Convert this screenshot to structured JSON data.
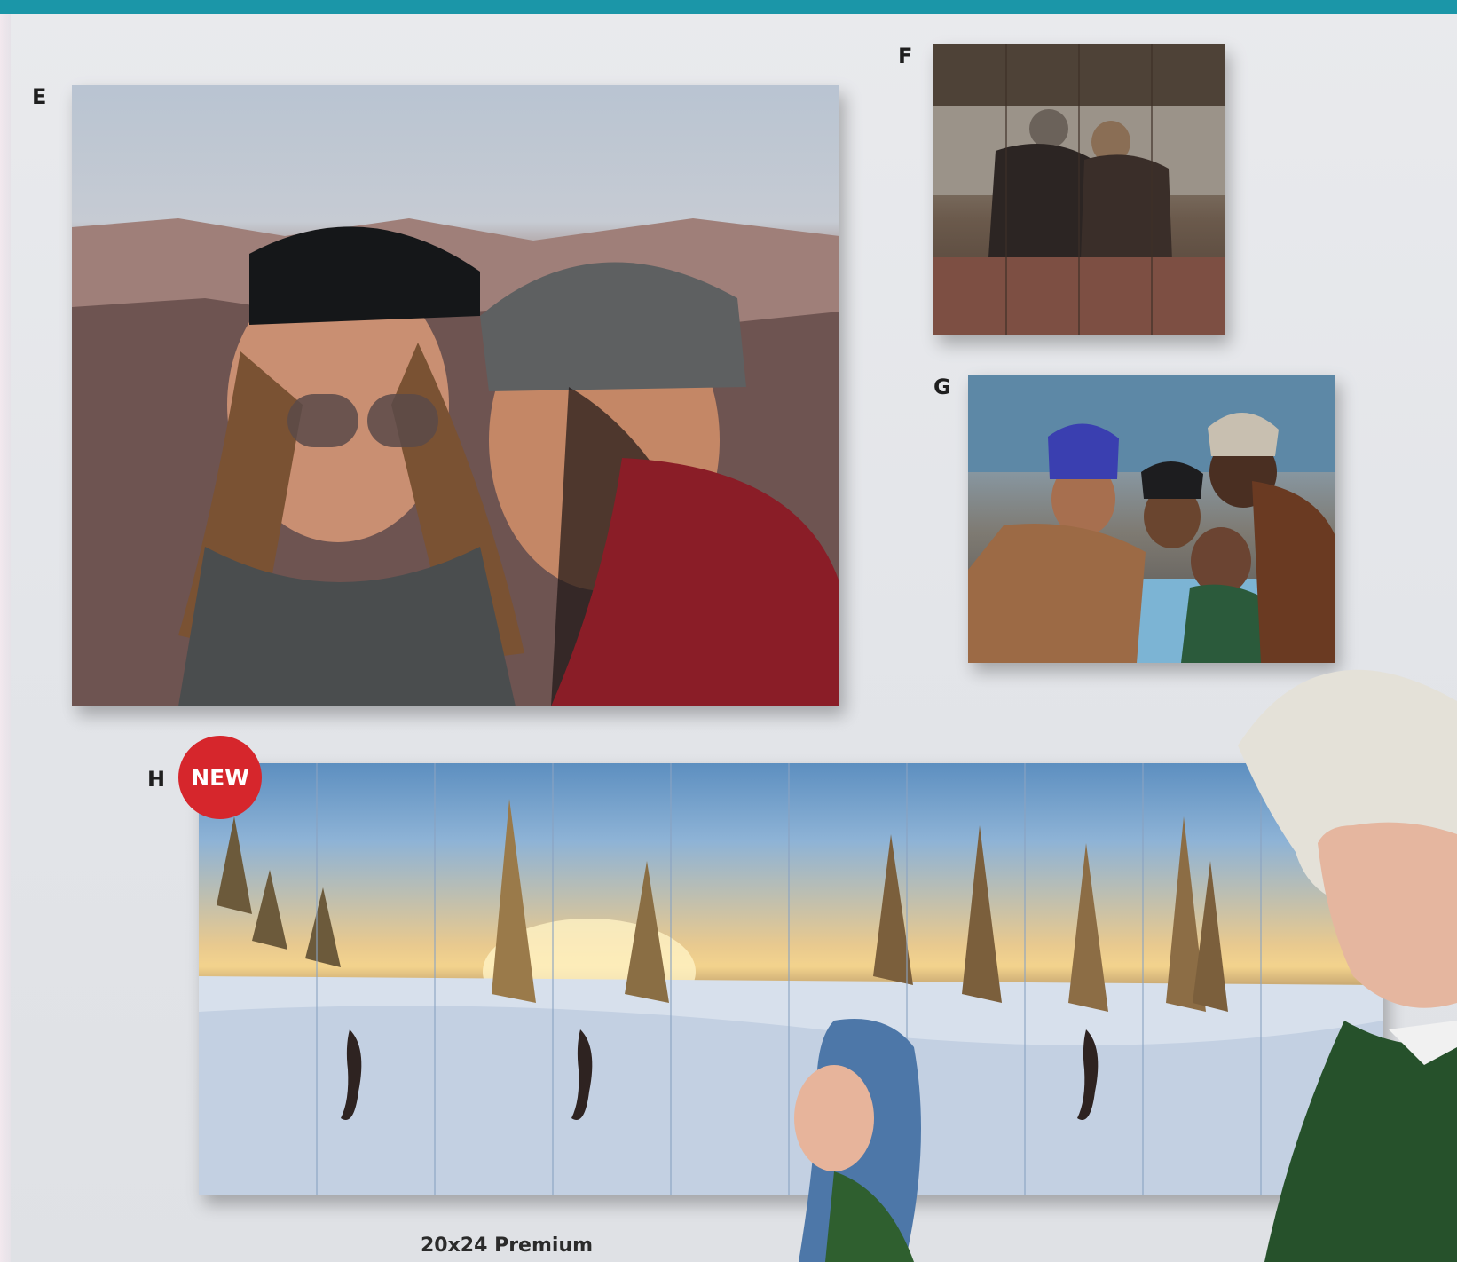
{
  "colors": {
    "top_bar": "#1b96a8",
    "badge": "#d6262c"
  },
  "labels": {
    "e": "E",
    "f": "F",
    "g": "G",
    "h": "H",
    "new_badge": "NEW"
  },
  "caption": "20x24 Premium"
}
